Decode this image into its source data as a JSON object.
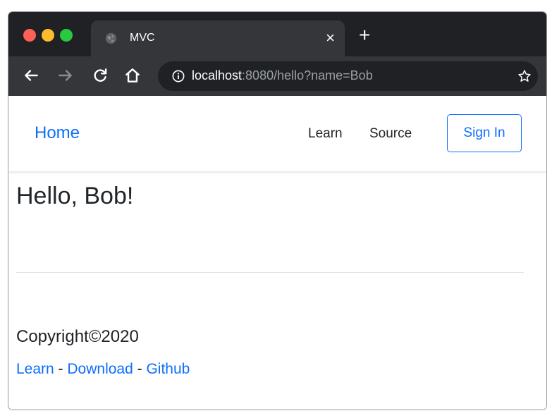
{
  "browser": {
    "tab_title": "MVC",
    "tab_close": "×",
    "new_tab": "+",
    "url_host": "localhost",
    "url_rest": ":8080/hello?name=Bob"
  },
  "navbar": {
    "brand": "Home",
    "links": [
      "Learn",
      "Source"
    ],
    "sign_in": "Sign In"
  },
  "main": {
    "heading": "Hello, Bob!"
  },
  "footer": {
    "copyright": "Copyright©2020",
    "links": [
      "Learn",
      "Download",
      "Github"
    ],
    "separator": " - "
  },
  "colors": {
    "accent": "#0d6efd",
    "chrome_dark": "#202124",
    "chrome_tab": "#35363a"
  }
}
